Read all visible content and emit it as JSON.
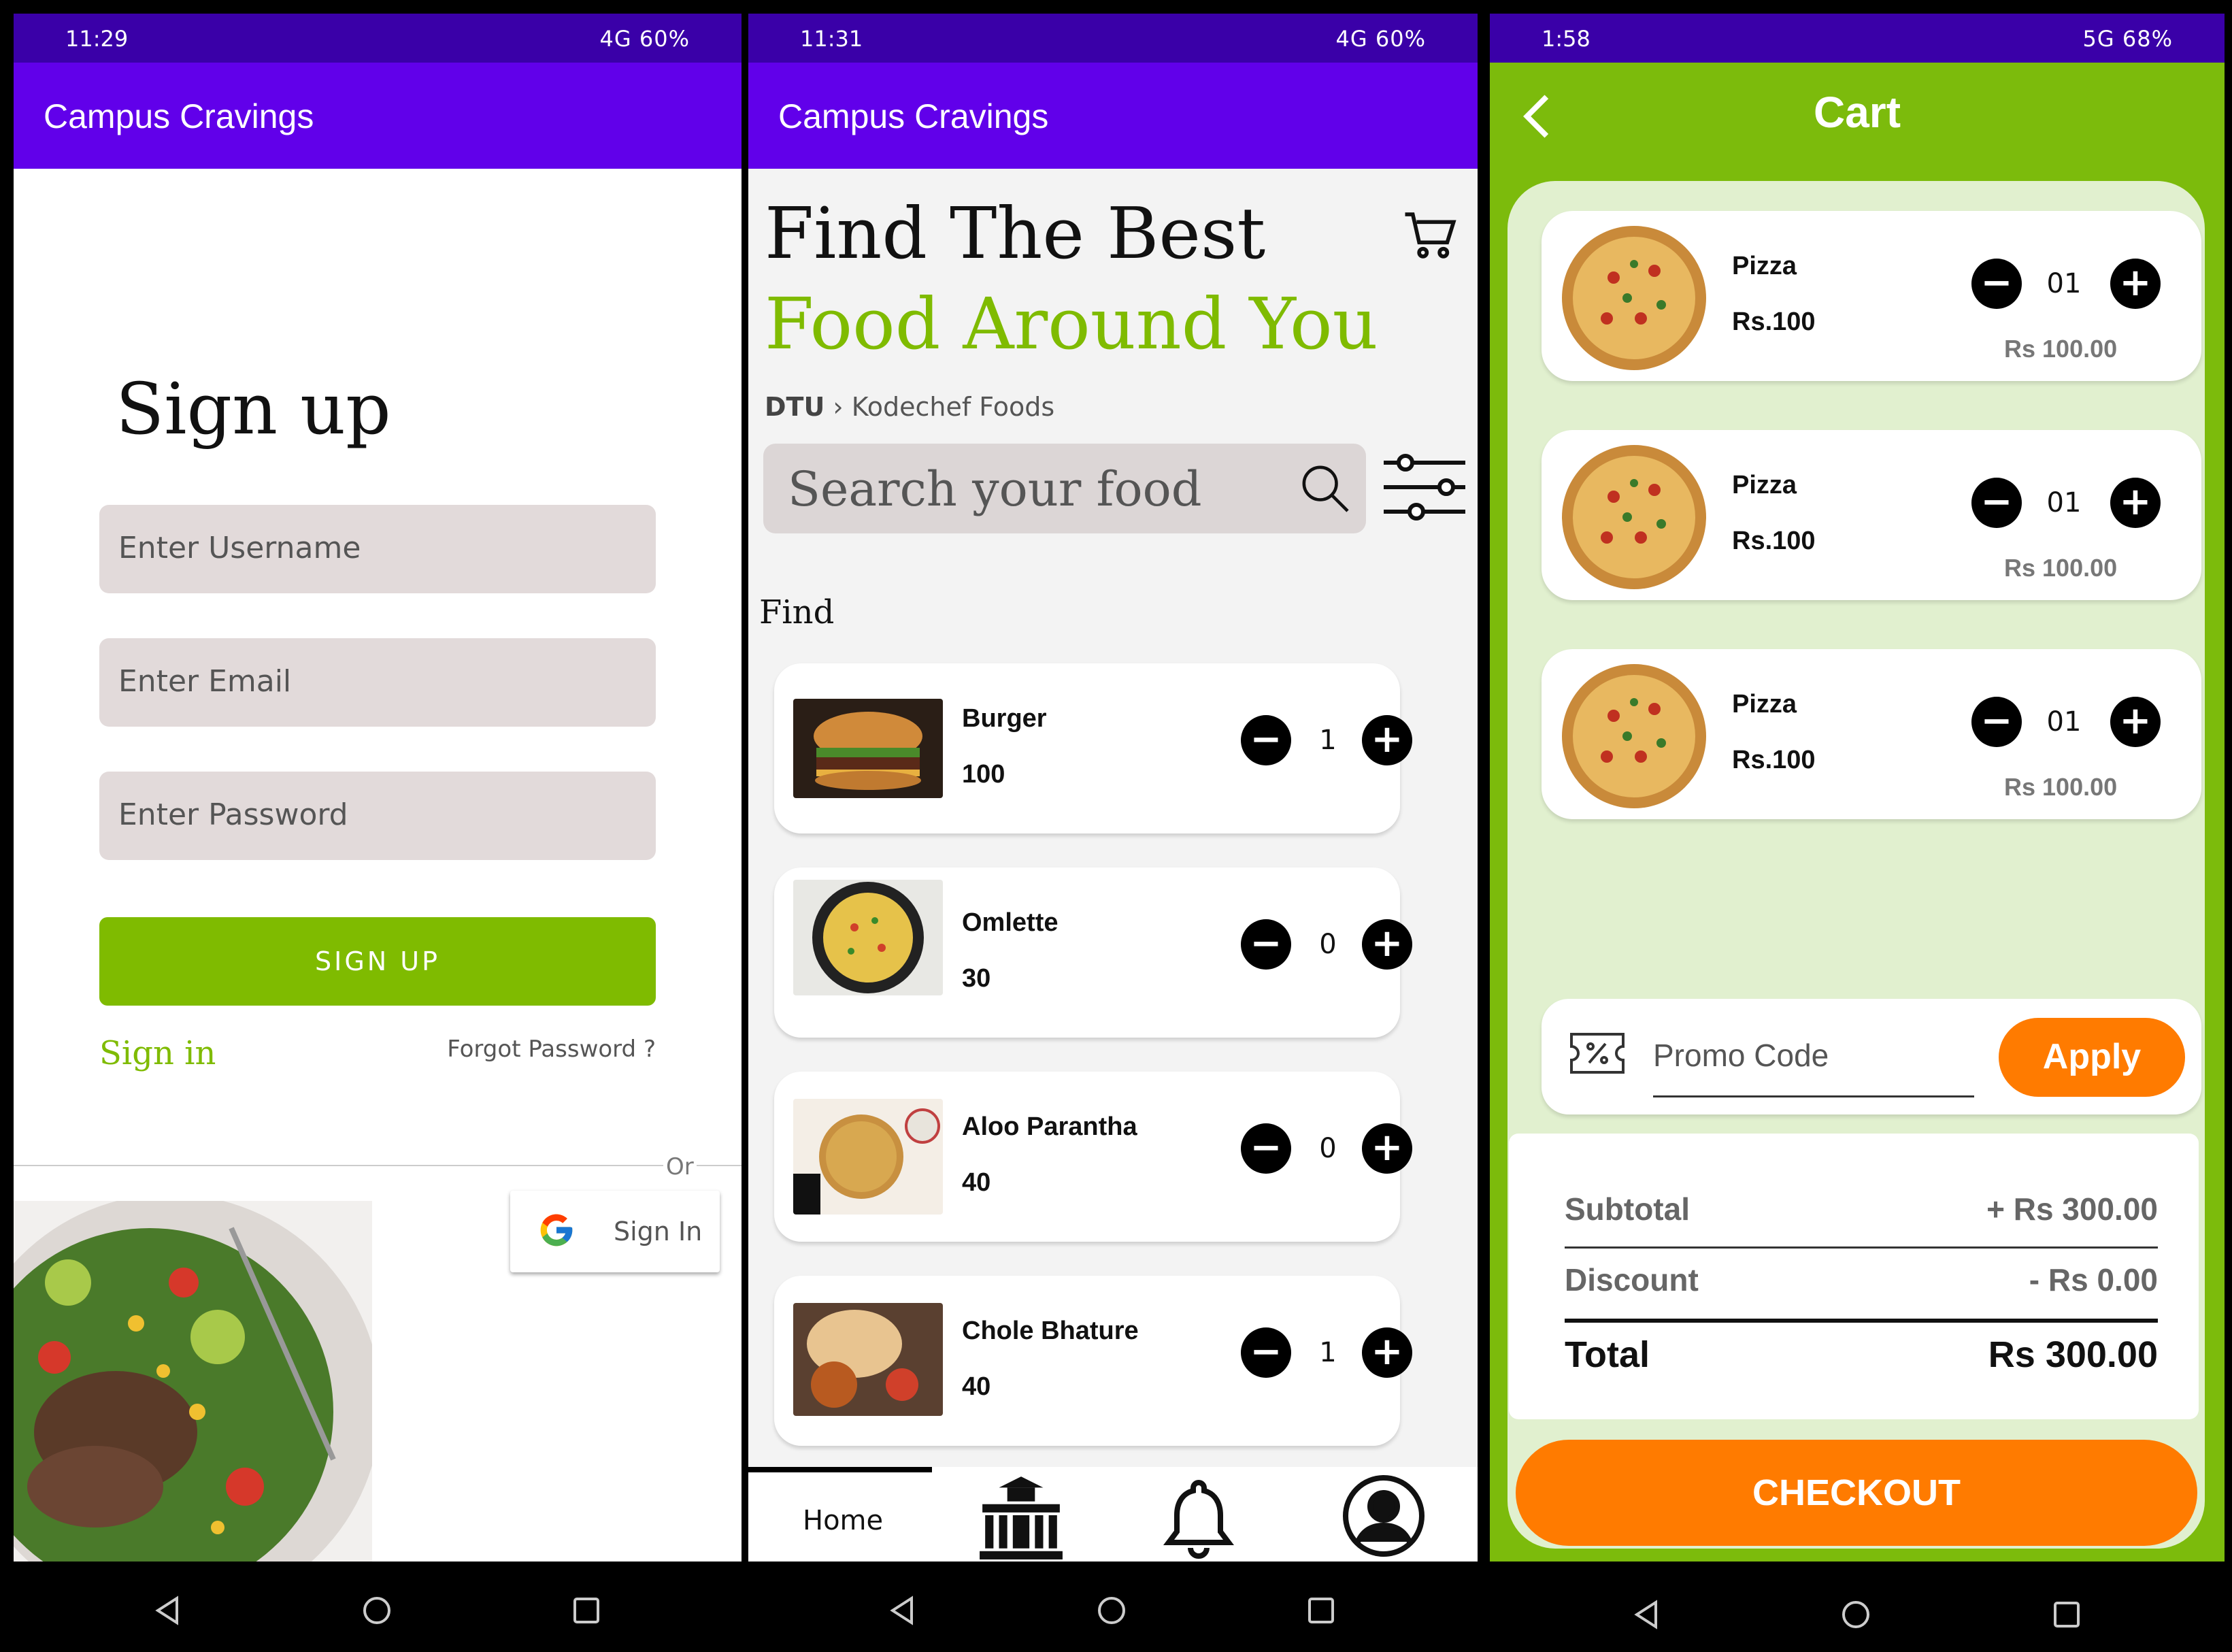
{
  "screen1": {
    "status": {
      "time": "11:29",
      "right": "4G  60%"
    },
    "app_title": "Campus Cravings",
    "heading": "Sign up",
    "username_placeholder": "Enter Username",
    "email_placeholder": "Enter Email",
    "password_placeholder": "Enter Password",
    "signup_button": "SIGN UP",
    "signin_link": "Sign in",
    "forgot_link": "Forgot Password ?",
    "or_label": "Or",
    "google_button": "Sign In"
  },
  "screen2": {
    "status": {
      "time": "11:31",
      "right": "4G  60%"
    },
    "app_title": "Campus Cravings",
    "headline1": "Find The Best",
    "headline2": "Food Around You",
    "breadcrumb": {
      "root": "DTU",
      "current": "Kodechef Foods"
    },
    "search_placeholder": "Search your food",
    "section_label": "Find",
    "items": [
      {
        "name": "Burger",
        "price": "100",
        "qty": "1"
      },
      {
        "name": "Omlette",
        "price": "30",
        "qty": "0"
      },
      {
        "name": "Aloo Parantha",
        "price": "40",
        "qty": "0"
      },
      {
        "name": "Chole Bhature",
        "price": "40",
        "qty": "1"
      }
    ],
    "nav": {
      "home": "Home"
    }
  },
  "screen3": {
    "status": {
      "time": "1:58",
      "right": "5G  68%"
    },
    "title": "Cart",
    "items": [
      {
        "name": "Pizza",
        "price": "Rs.100",
        "qty": "01",
        "total": "Rs 100.00"
      },
      {
        "name": "Pizza",
        "price": "Rs.100",
        "qty": "01",
        "total": "Rs 100.00"
      },
      {
        "name": "Pizza",
        "price": "Rs.100",
        "qty": "01",
        "total": "Rs 100.00"
      }
    ],
    "promo_placeholder": "Promo Code",
    "apply_button": "Apply",
    "subtotal_label": "Subtotal",
    "subtotal_value": "+ Rs 300.00",
    "discount_label": "Discount",
    "discount_value": "- Rs 0.00",
    "total_label": "Total",
    "total_value": "Rs 300.00",
    "checkout_button": "CHECKOUT"
  },
  "colors": {
    "primary": "#6100ea",
    "green": "#7fbb00",
    "orange": "#ff7b00"
  },
  "icons": [
    "search-icon",
    "cart-icon",
    "filter-icon",
    "google-icon",
    "back-icon",
    "promo-icon",
    "bell-icon",
    "profile-icon",
    "building-icon"
  ]
}
